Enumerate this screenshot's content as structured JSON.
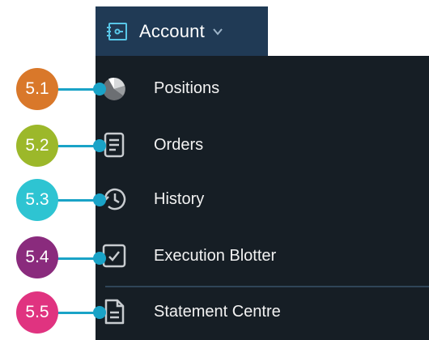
{
  "account_menu": {
    "button_label": "Account",
    "items": [
      {
        "label": "Positions",
        "icon": "pie-chart-icon"
      },
      {
        "label": "Orders",
        "icon": "document-list-icon"
      },
      {
        "label": "History",
        "icon": "history-clock-icon"
      },
      {
        "label": "Execution Blotter",
        "icon": "checkbox-check-icon"
      },
      {
        "label": "Statement Centre",
        "icon": "statement-document-icon"
      }
    ]
  },
  "callouts": [
    {
      "label": "5.1",
      "color": "#d9782a"
    },
    {
      "label": "5.2",
      "color": "#9cb82a"
    },
    {
      "label": "5.3",
      "color": "#2ec4d2"
    },
    {
      "label": "5.4",
      "color": "#8a2b7d"
    },
    {
      "label": "5.5",
      "color": "#e03380"
    }
  ],
  "colors": {
    "button_bg": "#203a55",
    "menu_bg": "#161e25",
    "leader_line": "#1aa3c7",
    "icon_stroke": "#c8ccd0"
  }
}
